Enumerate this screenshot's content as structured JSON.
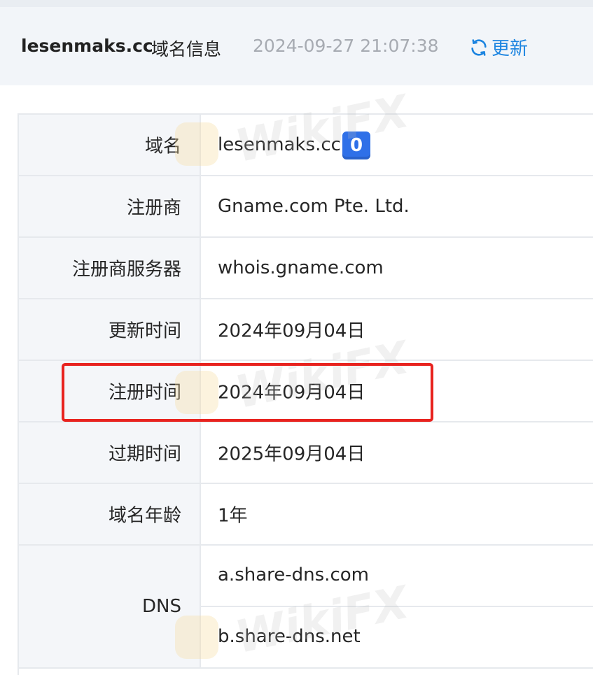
{
  "header": {
    "domain": "lesenmaks.cc",
    "title": "域名信息",
    "timestamp": "2024-09-27 21:07:38",
    "refresh_label": "更新"
  },
  "rows": [
    {
      "label": "域名",
      "value": "lesenmaks.cc",
      "badge": "0"
    },
    {
      "label": "注册商",
      "value": "Gname.com Pte. Ltd."
    },
    {
      "label": "注册商服务器",
      "value": "whois.gname.com"
    },
    {
      "label": "更新时间",
      "value": "2024年09月04日"
    },
    {
      "label": "注册时间",
      "value": "2024年09月04日"
    },
    {
      "label": "过期时间",
      "value": "2025年09月04日"
    },
    {
      "label": "域名年龄",
      "value": "1年"
    }
  ],
  "dns": {
    "label": "DNS",
    "values": [
      "a.share-dns.com",
      "b.share-dns.net"
    ]
  },
  "watermark_text": "WikiFX",
  "colors": {
    "accent": "#1c84e0",
    "badge": "#2f70e8",
    "highlight": "#e8231f",
    "header_bg": "#f2f5f9",
    "label_bg": "#f4f6f9"
  }
}
